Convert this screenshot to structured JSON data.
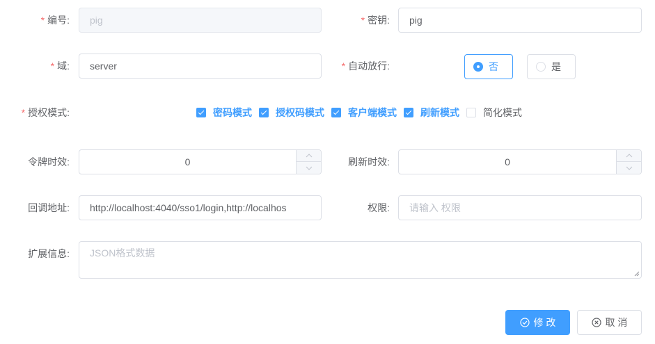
{
  "form": {
    "id": {
      "label": "编号:",
      "value": "pig"
    },
    "secret": {
      "label": "密钥:",
      "value": "pig"
    },
    "scope": {
      "label": "域:",
      "value": "server"
    },
    "auto_approve": {
      "label": "自动放行:",
      "options": [
        "否",
        "是"
      ],
      "selected": "否"
    },
    "grant_types": {
      "label": "授权模式:",
      "items": [
        {
          "label": "密码模式",
          "checked": true
        },
        {
          "label": "授权码模式",
          "checked": true
        },
        {
          "label": "客户端模式",
          "checked": true
        },
        {
          "label": "刷新模式",
          "checked": true
        },
        {
          "label": "简化模式",
          "checked": false
        }
      ]
    },
    "access_token_validity": {
      "label": "令牌时效:",
      "value": "0"
    },
    "refresh_token_validity": {
      "label": "刷新时效:",
      "value": "0"
    },
    "redirect_uri": {
      "label": "回调地址:",
      "value": "http://localhost:4040/sso1/login,http://localhos"
    },
    "authorities": {
      "label": "权限:",
      "placeholder": "请输入 权限"
    },
    "additional_info": {
      "label": "扩展信息:",
      "placeholder": "JSON格式数据"
    }
  },
  "buttons": {
    "submit": "修 改",
    "cancel": "取 消"
  },
  "colors": {
    "primary": "#409eff",
    "required": "#f56c6c",
    "border": "#dcdfe6"
  },
  "icons": {
    "submit": "check-circle-icon",
    "cancel": "close-circle-icon"
  }
}
